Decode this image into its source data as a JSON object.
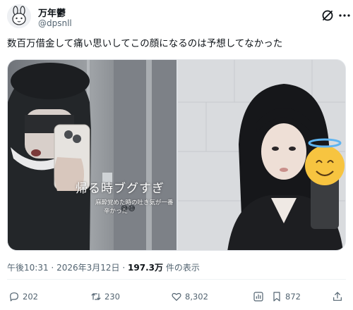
{
  "tweet": {
    "display_name": "万年鬱",
    "handle": "@dpsnll",
    "text": "数百万借金して痛い思いしてこの顔になるのは予想してなかった",
    "time": "午後10:31",
    "separator": "·",
    "date": "2026年3月12日",
    "views_count": "197.3万",
    "views_label": "件の表示"
  },
  "media": {
    "overlay_main": "帰る時ブグすぎ",
    "overlay_sub_line1": "麻酔覚めた時の吐き気が一番",
    "overlay_sub_line2": "辛かった"
  },
  "actions": {
    "replies": "202",
    "reposts": "230",
    "likes": "8,302",
    "bookmarks": "872"
  },
  "icons": {
    "more": "more-horizontal-icon",
    "grok": "grok-icon",
    "reply": "speech-bubble-icon",
    "repost": "repost-arrows-icon",
    "like": "heart-icon",
    "views": "bar-chart-icon",
    "bookmark": "bookmark-icon",
    "share": "share-upload-icon"
  },
  "colors": {
    "text": "#0f1419",
    "secondary": "#536471",
    "divider": "#eff3f4"
  }
}
